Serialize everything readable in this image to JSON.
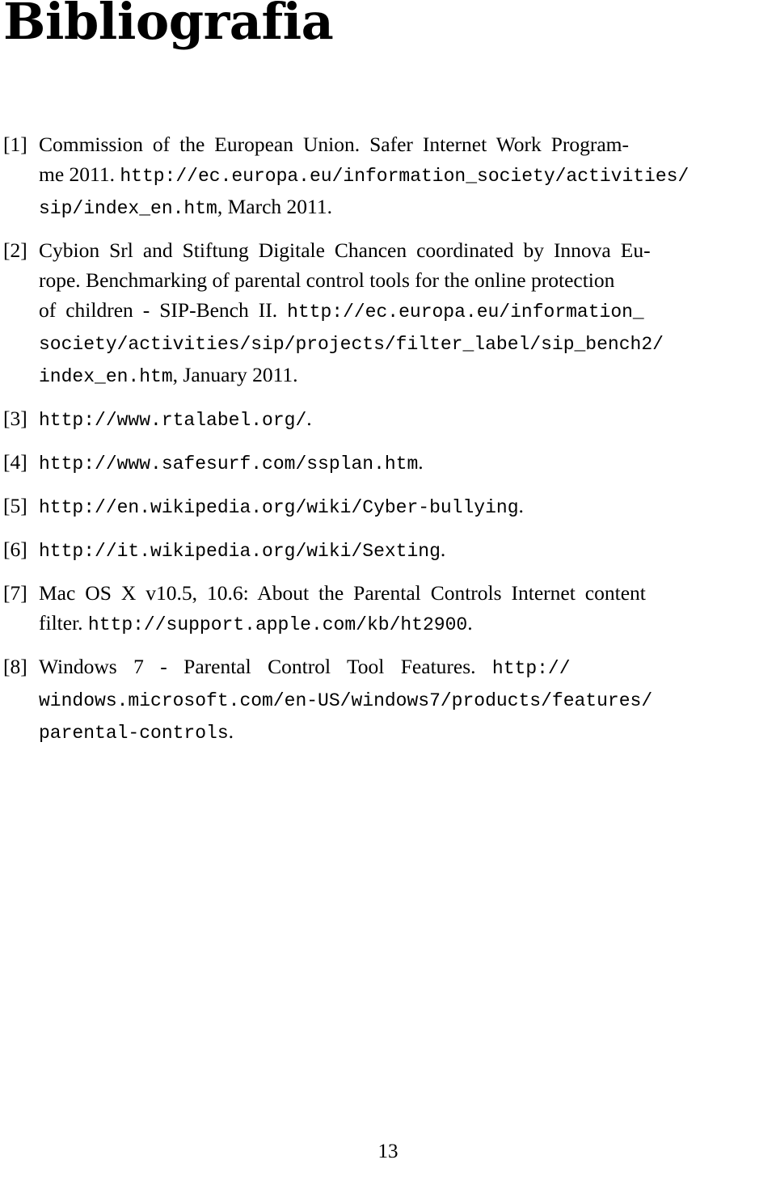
{
  "document": {
    "title": "Bibliografia",
    "page_number": "13"
  },
  "references": [
    {
      "label": "[1]",
      "lines": [
        {
          "segments": [
            {
              "style": "serif",
              "text": "Commission of the European Union. Safer Internet Work Program-"
            }
          ]
        },
        {
          "segments": [
            {
              "style": "serif",
              "text": "me 2011. "
            },
            {
              "style": "mono",
              "text": "http://ec.europa.eu/information_society/activities/"
            }
          ]
        },
        {
          "segments": [
            {
              "style": "mono",
              "text": "sip/index_en.htm"
            },
            {
              "style": "serif",
              "text": ", March 2011."
            }
          ]
        }
      ],
      "plain": "Commission of the European Union. Safer Internet Work Programme 2011. http://ec.europa.eu/information_society/activities/sip/index_en.htm, March 2011."
    },
    {
      "label": "[2]",
      "lines": [
        {
          "segments": [
            {
              "style": "serif",
              "text": "Cybion Srl and Stiftung Digitale Chancen coordinated by Innova Eu-"
            }
          ]
        },
        {
          "segments": [
            {
              "style": "serif",
              "text": "rope. Benchmarking of parental control tools for the online protection"
            }
          ]
        },
        {
          "segments": [
            {
              "style": "serif",
              "text": "of children - SIP-Bench II. "
            },
            {
              "style": "mono",
              "text": "http://ec.europa.eu/information_"
            }
          ]
        },
        {
          "segments": [
            {
              "style": "mono",
              "text": "society/activities/sip/projects/filter_label/sip_bench2/"
            }
          ]
        },
        {
          "segments": [
            {
              "style": "mono",
              "text": "index_en.htm"
            },
            {
              "style": "serif",
              "text": ", January 2011."
            }
          ]
        }
      ],
      "plain": "Cybion Srl and Stiftung Digitale Chancen coordinated by Innova Europe. Benchmarking of parental control tools for the online protection of children - SIP-Bench II. http://ec.europa.eu/information_society/activities/sip/projects/filter_label/sip_bench2/index_en.htm, January 2011."
    },
    {
      "label": "[3]",
      "lines": [
        {
          "segments": [
            {
              "style": "mono",
              "text": "http://www.rtalabel.org/"
            },
            {
              "style": "serif",
              "text": "."
            }
          ]
        }
      ],
      "plain": "http://www.rtalabel.org/."
    },
    {
      "label": "[4]",
      "lines": [
        {
          "segments": [
            {
              "style": "mono",
              "text": "http://www.safesurf.com/ssplan.htm"
            },
            {
              "style": "serif",
              "text": "."
            }
          ]
        }
      ],
      "plain": "http://www.safesurf.com/ssplan.htm."
    },
    {
      "label": "[5]",
      "lines": [
        {
          "segments": [
            {
              "style": "mono",
              "text": "http://en.wikipedia.org/wiki/Cyber-bullying"
            },
            {
              "style": "serif",
              "text": "."
            }
          ]
        }
      ],
      "plain": "http://en.wikipedia.org/wiki/Cyber-bullying."
    },
    {
      "label": "[6]",
      "lines": [
        {
          "segments": [
            {
              "style": "mono",
              "text": "http://it.wikipedia.org/wiki/Sexting"
            },
            {
              "style": "serif",
              "text": "."
            }
          ]
        }
      ],
      "plain": "http://it.wikipedia.org/wiki/Sexting."
    },
    {
      "label": "[7]",
      "lines": [
        {
          "segments": [
            {
              "style": "serif",
              "text": "Mac OS X v10.5, 10.6: About the Parental Controls Internet content"
            }
          ]
        },
        {
          "segments": [
            {
              "style": "serif",
              "text": "filter. "
            },
            {
              "style": "mono",
              "text": "http://support.apple.com/kb/ht2900"
            },
            {
              "style": "serif",
              "text": "."
            }
          ]
        }
      ],
      "plain": "Mac OS X v10.5, 10.6: About the Parental Controls Internet content filter. http://support.apple.com/kb/ht2900."
    },
    {
      "label": "[8]",
      "lines": [
        {
          "segments": [
            {
              "style": "serif",
              "text": "Windows 7 - Parental Control Tool Features. "
            },
            {
              "style": "mono",
              "text": "http://"
            }
          ]
        },
        {
          "segments": [
            {
              "style": "mono",
              "text": "windows.microsoft.com/en-US/windows7/products/features/"
            }
          ]
        },
        {
          "segments": [
            {
              "style": "mono",
              "text": "parental-controls"
            },
            {
              "style": "serif",
              "text": "."
            }
          ]
        }
      ],
      "plain": "Windows 7 - Parental Control Tool Features. http://windows.microsoft.com/en-US/windows7/products/features/parental-controls."
    }
  ]
}
